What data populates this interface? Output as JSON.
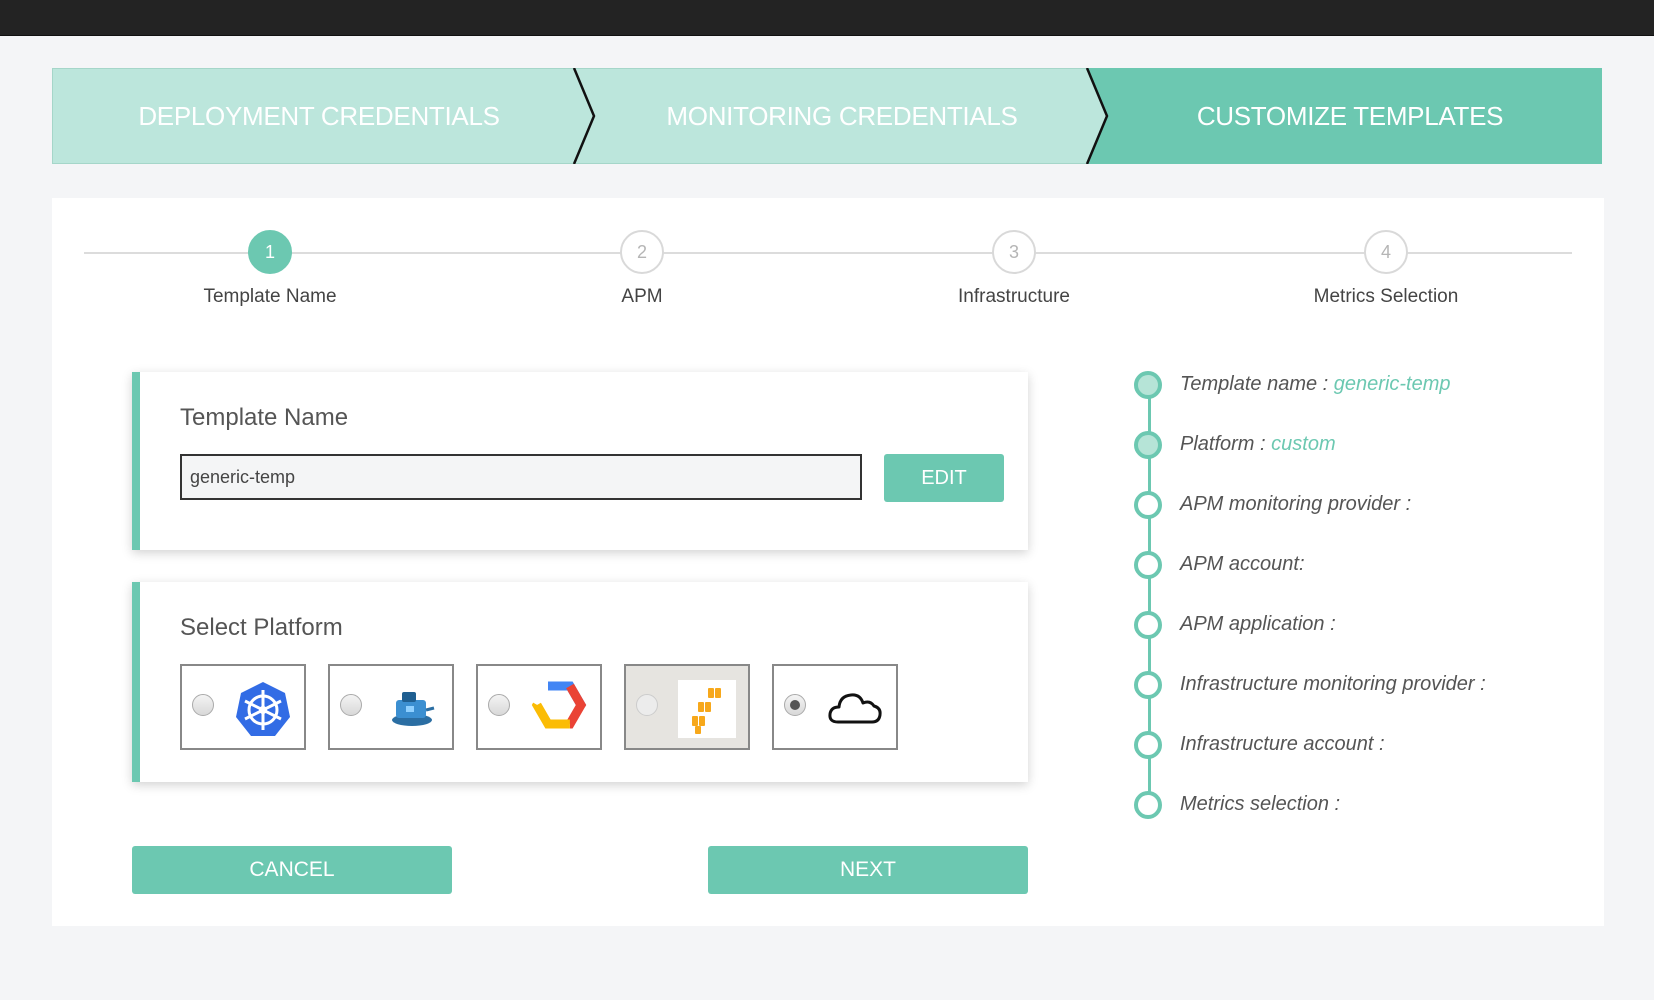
{
  "wizard": {
    "steps": [
      {
        "label": "DEPLOYMENT CREDENTIALS"
      },
      {
        "label": "MONITORING CREDENTIALS"
      },
      {
        "label": "CUSTOMIZE TEMPLATES"
      }
    ],
    "active_index": 2
  },
  "stepper": {
    "steps": [
      {
        "number": "1",
        "label": "Template Name"
      },
      {
        "number": "2",
        "label": "APM"
      },
      {
        "number": "3",
        "label": "Infrastructure"
      },
      {
        "number": "4",
        "label": "Metrics Selection"
      }
    ],
    "active_index": 0
  },
  "template_card": {
    "title": "Template Name",
    "input_value": "generic-temp",
    "edit_label": "EDIT"
  },
  "platform_card": {
    "title": "Select Platform",
    "options": [
      {
        "icon": "kubernetes-icon"
      },
      {
        "icon": "docker-swarm-icon"
      },
      {
        "icon": "google-cloud-icon"
      },
      {
        "icon": "aws-icon"
      },
      {
        "icon": "cloud-icon"
      }
    ],
    "selected_index": 4
  },
  "buttons": {
    "cancel": "CANCEL",
    "next": "NEXT"
  },
  "summary": {
    "items": [
      {
        "label": "Template name :",
        "value": "generic-temp"
      },
      {
        "label": "Platform :",
        "value": "custom"
      },
      {
        "label": "APM monitoring provider :",
        "value": ""
      },
      {
        "label": "APM account:",
        "value": ""
      },
      {
        "label": "APM application :",
        "value": ""
      },
      {
        "label": "Infrastructure monitoring provider :",
        "value": ""
      },
      {
        "label": "Infrastructure account :",
        "value": ""
      },
      {
        "label": "Metrics selection :",
        "value": ""
      }
    ]
  },
  "colors": {
    "accent": "#6cc8b1",
    "accent_light": "#bce6dc",
    "topbar": "#232323"
  }
}
